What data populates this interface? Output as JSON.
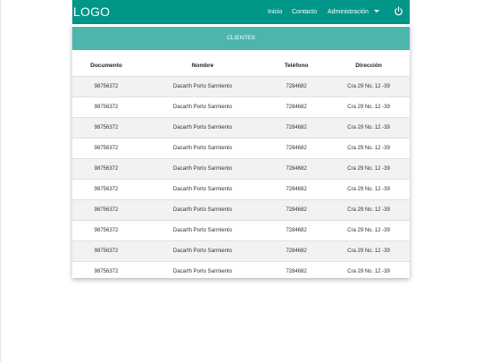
{
  "navbar": {
    "logo": "LOGO",
    "links": [
      "Inicio",
      "Contacto",
      "Administración"
    ],
    "power_icon": "power-icon",
    "dropdown_icon": "chevron-down-icon",
    "color": "#009688"
  },
  "card": {
    "title": "CLIENTES",
    "header_color": "#4db6ac"
  },
  "table": {
    "columns": [
      "Documento",
      "Nombre",
      "Teléfono",
      "Dirección"
    ],
    "rows": [
      [
        "98756372",
        "Dacarth Porto Sarmiento",
        "7284682",
        "Cra 29 No. 12 -39"
      ],
      [
        "98756372",
        "Dacarth Porto Sarmiento",
        "7284682",
        "Cra 29 No. 12 -39"
      ],
      [
        "98756372",
        "Dacarth Porto Sarmiento",
        "7284682",
        "Cra 29 No. 12 -39"
      ],
      [
        "98756372",
        "Dacarth Porto Sarmiento",
        "7284682",
        "Cra 29 No. 12 -39"
      ],
      [
        "98756372",
        "Dacarth Porto Sarmiento",
        "7284682",
        "Cra 29 No. 12 -39"
      ],
      [
        "98756372",
        "Dacarth Porto Sarmiento",
        "7284682",
        "Cra 29 No. 12 -39"
      ],
      [
        "98756372",
        "Dacarth Porto Sarmiento",
        "7284682",
        "Cra 29 No. 12 -39"
      ],
      [
        "98756372",
        "Dacarth Porto Sarmiento",
        "7284682",
        "Cra 29 No. 12 -39"
      ],
      [
        "98756372",
        "Dacarth Porto Sarmiento",
        "7284682",
        "Cra 29 No. 12 -39"
      ],
      [
        "98756372",
        "Dacarth Porto Sarmiento",
        "7284682",
        "Cra 29 No. 12 -39"
      ]
    ]
  }
}
